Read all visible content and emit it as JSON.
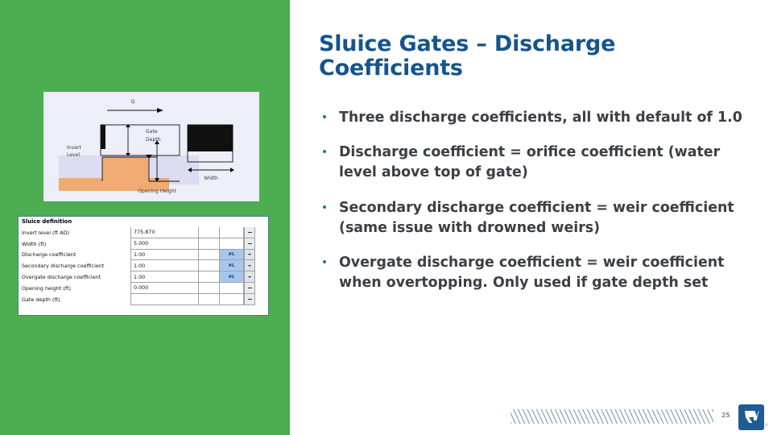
{
  "slide": {
    "page_number": "25",
    "accent_green": "#4CAE50",
    "title_blue": "#16548C",
    "body_gray": "#3B4044",
    "bullet_blue": "#1F6FA8"
  },
  "title": {
    "line1": "Sluice Gates – Discharge",
    "line2": "Coefficients"
  },
  "bullets": [
    {
      "text": "Three discharge coefficients, all with default of 1.0"
    },
    {
      "text": "Discharge coefficient = orifice coefficient (water level above top of gate)"
    },
    {
      "text": "Secondary discharge coefficient = weir coefficient (same issue with drowned weirs)"
    },
    {
      "text": "Overgate discharge coefficient = weir coefficient when overtopping. Only used if gate depth set"
    }
  ],
  "diagram": {
    "caption_flow": "Q",
    "label_invert": "Invert",
    "label_level": "Level",
    "label_gate": "Gate",
    "label_depth": "Depth",
    "label_opening": "Opening Height",
    "label_width": "Width"
  },
  "properties": {
    "title": "Sluice definition",
    "rows": [
      {
        "label": "Invert level (ft AD)",
        "value": "775.870",
        "tag": "",
        "tag_filled": false,
        "caret": "flat"
      },
      {
        "label": "Width (ft)",
        "value": "5.000",
        "tag": "",
        "tag_filled": false,
        "caret": "flat"
      },
      {
        "label": "Discharge coefficient",
        "value": "1.00",
        "tag": "#L",
        "tag_filled": true,
        "caret": "down"
      },
      {
        "label": "Secondary discharge coefficient",
        "value": "1.00",
        "tag": "#L",
        "tag_filled": true,
        "caret": "down"
      },
      {
        "label": "Overgate discharge coefficient",
        "value": "1.00",
        "tag": "#L",
        "tag_filled": true,
        "caret": "down"
      },
      {
        "label": "Opening height (ft)",
        "value": "0.000",
        "tag": "",
        "tag_filled": false,
        "caret": "flat"
      },
      {
        "label": "Gate depth (ft)",
        "value": "",
        "tag": "",
        "tag_filled": false,
        "caret": "flat"
      }
    ]
  },
  "footer": {
    "logo_text": "RV"
  }
}
